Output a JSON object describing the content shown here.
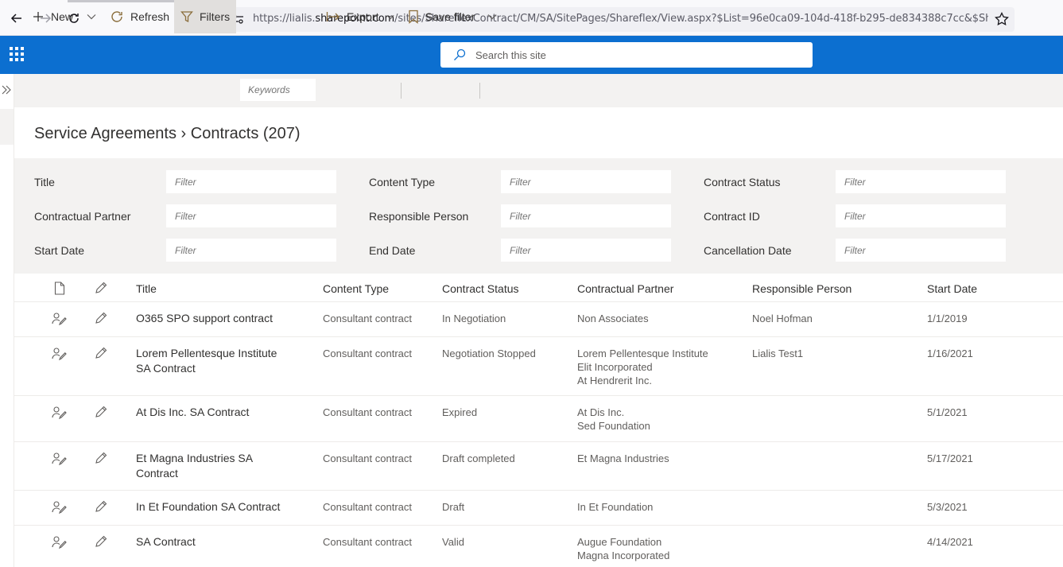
{
  "browser": {
    "url_prefix": "https://lialis.",
    "url_domain": "sharepoint.com",
    "url_rest": "/sites/ShareflexContract/CM/SA/SitePages/Shareflex/View.aspx?$List=96e0ca09-104d-418f-b295-de834388c7cc&$ShowFilt"
  },
  "suite": {
    "search_placeholder": "Search this site"
  },
  "commands": {
    "new": "New",
    "refresh": "Refresh",
    "filters": "Filters",
    "keywords_placeholder": "Keywords",
    "export": "Export",
    "save_filter": "Save filter"
  },
  "page": {
    "title": "Service Agreements › Contracts (207)"
  },
  "filters": {
    "placeholder": "Filter",
    "fields": [
      "Title",
      "Content Type",
      "Contract Status",
      "Contractual Partner",
      "Responsible Person",
      "Contract ID",
      "Start Date",
      "End Date",
      "Cancellation Date"
    ]
  },
  "table": {
    "columns": [
      "Title",
      "Content Type",
      "Contract Status",
      "Contractual Partner",
      "Responsible Person",
      "Start Date"
    ],
    "rows": [
      {
        "title": [
          "O365 SPO support contract"
        ],
        "content_type": "Consultant contract",
        "status": "In Negotiation",
        "partner": [
          "Non Associates"
        ],
        "person": "Noel Hofman",
        "start": "1/1/2019"
      },
      {
        "title": [
          "Lorem Pellentesque Institute",
          "SA Contract"
        ],
        "content_type": "Consultant contract",
        "status": "Negotiation Stopped",
        "partner": [
          "Lorem Pellentesque Institute",
          "Elit Incorporated",
          "At Hendrerit Inc."
        ],
        "person": "Lialis Test1",
        "start": "1/16/2021"
      },
      {
        "title": [
          "At Dis Inc. SA Contract"
        ],
        "content_type": "Consultant contract",
        "status": "Expired",
        "partner": [
          "At Dis Inc.",
          "Sed Foundation"
        ],
        "person": "",
        "start": "5/1/2021"
      },
      {
        "title": [
          "Et Magna Industries SA",
          "Contract"
        ],
        "content_type": "Consultant contract",
        "status": "Draft completed",
        "partner": [
          "Et Magna Industries"
        ],
        "person": "",
        "start": "5/17/2021"
      },
      {
        "title": [
          "In Et Foundation SA Contract"
        ],
        "content_type": "Consultant contract",
        "status": "Draft",
        "partner": [
          "In Et Foundation"
        ],
        "person": "",
        "start": "5/3/2021"
      },
      {
        "title": [
          "SA Contract"
        ],
        "content_type": "Consultant contract",
        "status": "Valid",
        "partner": [
          "Augue Foundation",
          "Magna Incorporated"
        ],
        "person": "",
        "start": "4/14/2021"
      }
    ]
  }
}
